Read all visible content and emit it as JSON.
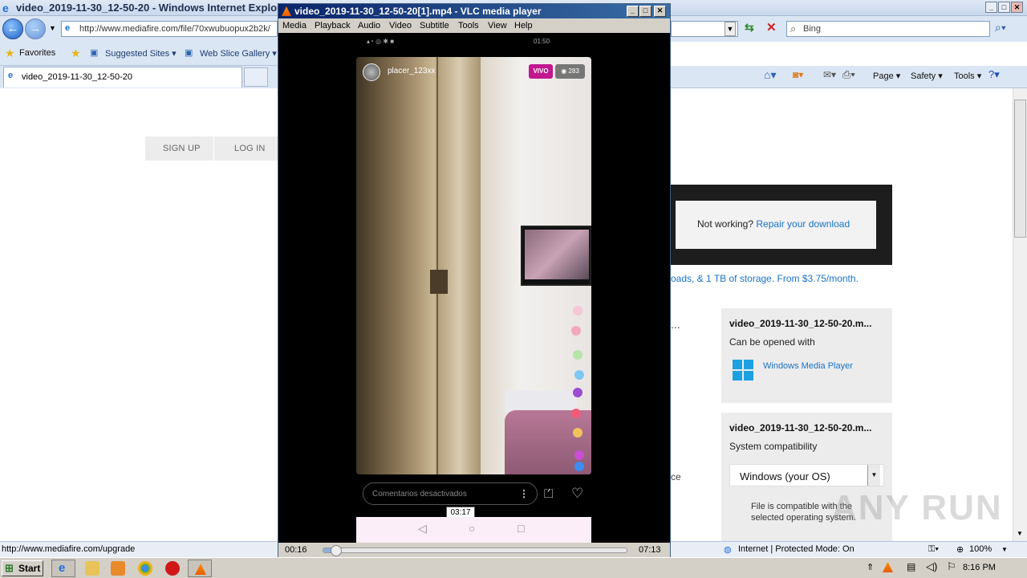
{
  "ie": {
    "title": "video_2019-11-30_12-50-20 - Windows Internet Explorer",
    "address": "http://www.mediafire.com/file/70xwubuopux2b2k/",
    "search_placeholder": "Bing",
    "favorites_label": "Favorites",
    "suggested_sites": "Suggested Sites ▾",
    "web_slice": "Web Slice Gallery ▾",
    "tab_label": "video_2019-11-30_12-50-20",
    "cmd": {
      "page": "Page ▾",
      "safety": "Safety ▾",
      "tools": "Tools ▾"
    },
    "status_url": "http://www.mediafire.com/upgrade",
    "status_zone": "Internet | Protected Mode: On",
    "zoom": "100%"
  },
  "mediafire": {
    "signup": "SIGN UP",
    "login": "LOG IN",
    "not_working": "Not working?",
    "repair": "Repair your download",
    "promo": "oads, & 1 TB of storage. From $3.75/month.",
    "ellipsis": "...",
    "ce": "ce",
    "card1": {
      "filename": "video_2019-11-30_12-50-20.m...",
      "subtitle": "Can be opened with",
      "app": "Windows Media Player"
    },
    "card2": {
      "filename": "video_2019-11-30_12-50-20.m...",
      "subtitle": "System compatibility",
      "os": "Windows (your OS)",
      "compat_line1": "File is compatible with the",
      "compat_line2": "selected operating system."
    },
    "watermark": "ANY RUN"
  },
  "vlc": {
    "title": "video_2019-11-30_12-50-20[1].mp4 - VLC media player",
    "menu": [
      "Media",
      "Playback",
      "Audio",
      "Video",
      "Subtitle",
      "Tools",
      "View",
      "Help"
    ],
    "elapsed": "00:16",
    "total": "07:13",
    "tooltip": "03:17",
    "progress_fraction": 0.037,
    "video": {
      "phone_time": "01:50",
      "username": "placer_123xx",
      "live_badge": "VIVO",
      "viewers": "283",
      "comments_placeholder": "Comentarios desactivados"
    }
  },
  "taskbar": {
    "start": "Start",
    "clock": "8:16 PM"
  }
}
